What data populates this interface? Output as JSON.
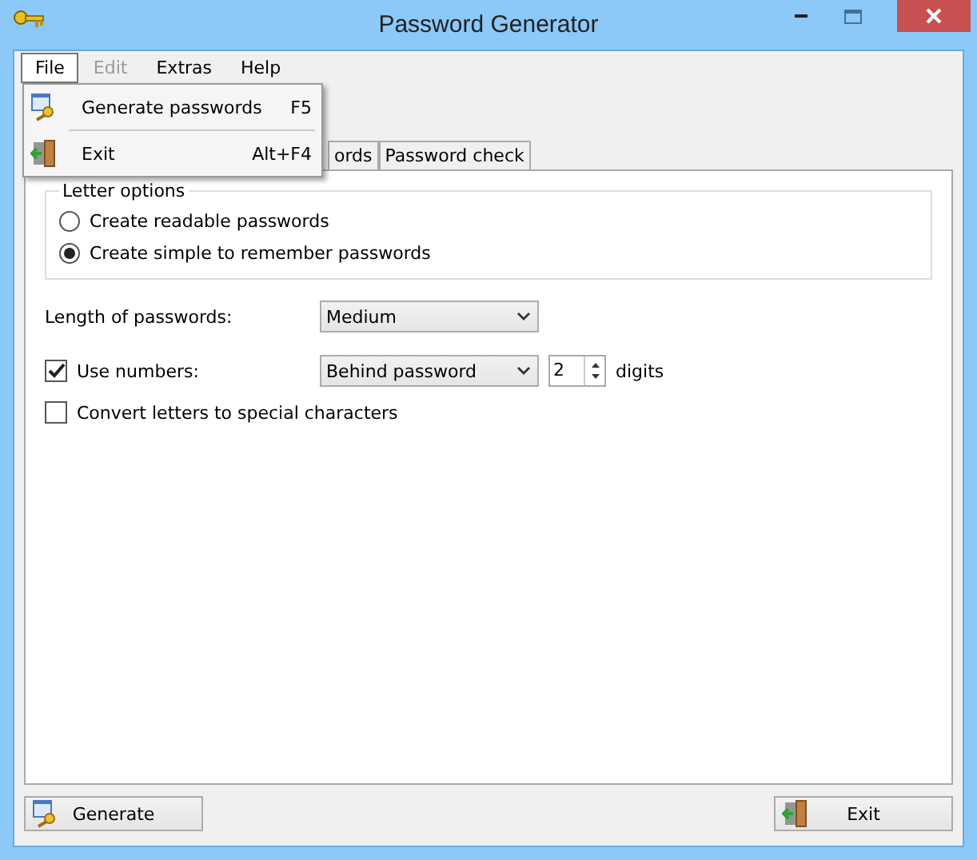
{
  "window": {
    "title": "Password Generator"
  },
  "menu_bar": [
    {
      "label": "File",
      "selected": true,
      "disabled": false
    },
    {
      "label": "Edit",
      "selected": false,
      "disabled": true
    },
    {
      "label": "Extras",
      "selected": false,
      "disabled": false
    },
    {
      "label": "Help",
      "selected": false,
      "disabled": false
    }
  ],
  "open_menu": [
    {
      "kind": "generate",
      "label": "Generate passwords",
      "shortcut": "F5"
    },
    {
      "kind": "exit",
      "label": "Exit",
      "shortcut": "Alt+F4"
    }
  ],
  "tabs": [
    {
      "label": "ords",
      "selected": false
    },
    {
      "label": "Password check",
      "selected": false
    }
  ],
  "letter_options": {
    "title": "Letter options",
    "options": [
      {
        "label": "Create readable passwords",
        "selected": false
      },
      {
        "label": "Create simple to remember passwords",
        "selected": true
      }
    ]
  },
  "length": {
    "label": "Length of passwords:",
    "value": "Medium"
  },
  "numbers": {
    "label": "Use numbers:",
    "checked": true,
    "position": "Behind password",
    "count": "2",
    "unit": "digits"
  },
  "special": {
    "label": "Convert letters to special characters",
    "checked": false
  },
  "buttons": [
    {
      "kind": "generate",
      "label": "Generate"
    },
    {
      "kind": "exit",
      "label": "Exit"
    }
  ]
}
